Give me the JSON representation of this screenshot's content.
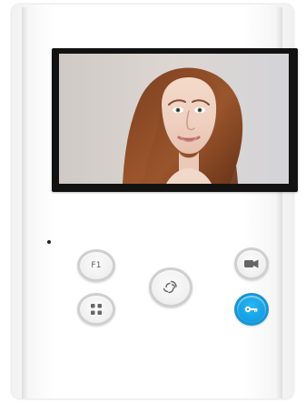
{
  "device": {
    "buttons": {
      "f1_label": "F1"
    },
    "icons": {
      "grid": "grid-icon",
      "voice": "voice-icon",
      "video": "video-camera-icon",
      "key": "key-icon"
    },
    "colors": {
      "device_body": "#ffffff",
      "screen_bezel": "#121212",
      "button_body": "#f4f4f4",
      "button_ring": "#cfcfcf",
      "key_button": "#17a3e7"
    }
  }
}
